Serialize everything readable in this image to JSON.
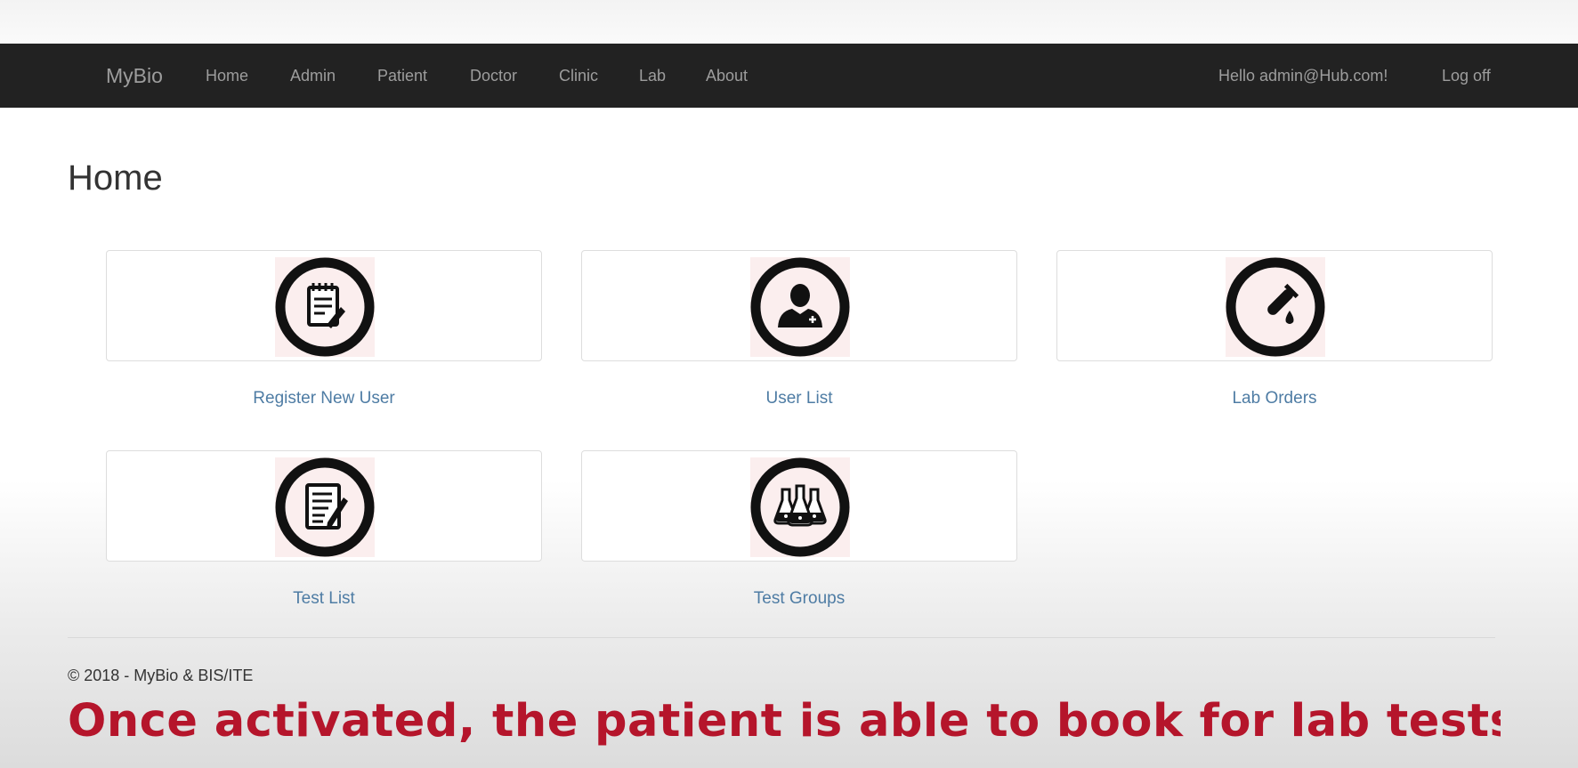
{
  "navbar": {
    "brand": "MyBio",
    "links": [
      "Home",
      "Admin",
      "Patient",
      "Doctor",
      "Clinic",
      "Lab",
      "About"
    ],
    "greeting": "Hello admin@Hub.com!",
    "logoff": "Log off"
  },
  "page": {
    "title": "Home"
  },
  "tiles": [
    {
      "label": "Register New User",
      "icon": "notepad-pencil-icon"
    },
    {
      "label": "User List",
      "icon": "user-add-icon"
    },
    {
      "label": "Lab Orders",
      "icon": "test-tube-drop-icon"
    },
    {
      "label": "Test List",
      "icon": "document-pen-icon"
    },
    {
      "label": "Test Groups",
      "icon": "lab-flasks-icon"
    }
  ],
  "footer": {
    "copyright": "© 2018 - MyBio & BIS/ITE"
  },
  "caption": {
    "text": "Once activated, the patient is able to book for lab tests"
  },
  "colors": {
    "navbar_bg": "#222222",
    "nav_text": "#9d9d9d",
    "link": "#4e7ca4",
    "caption": "#b5152b",
    "icon_bg": "#fbeeee"
  }
}
